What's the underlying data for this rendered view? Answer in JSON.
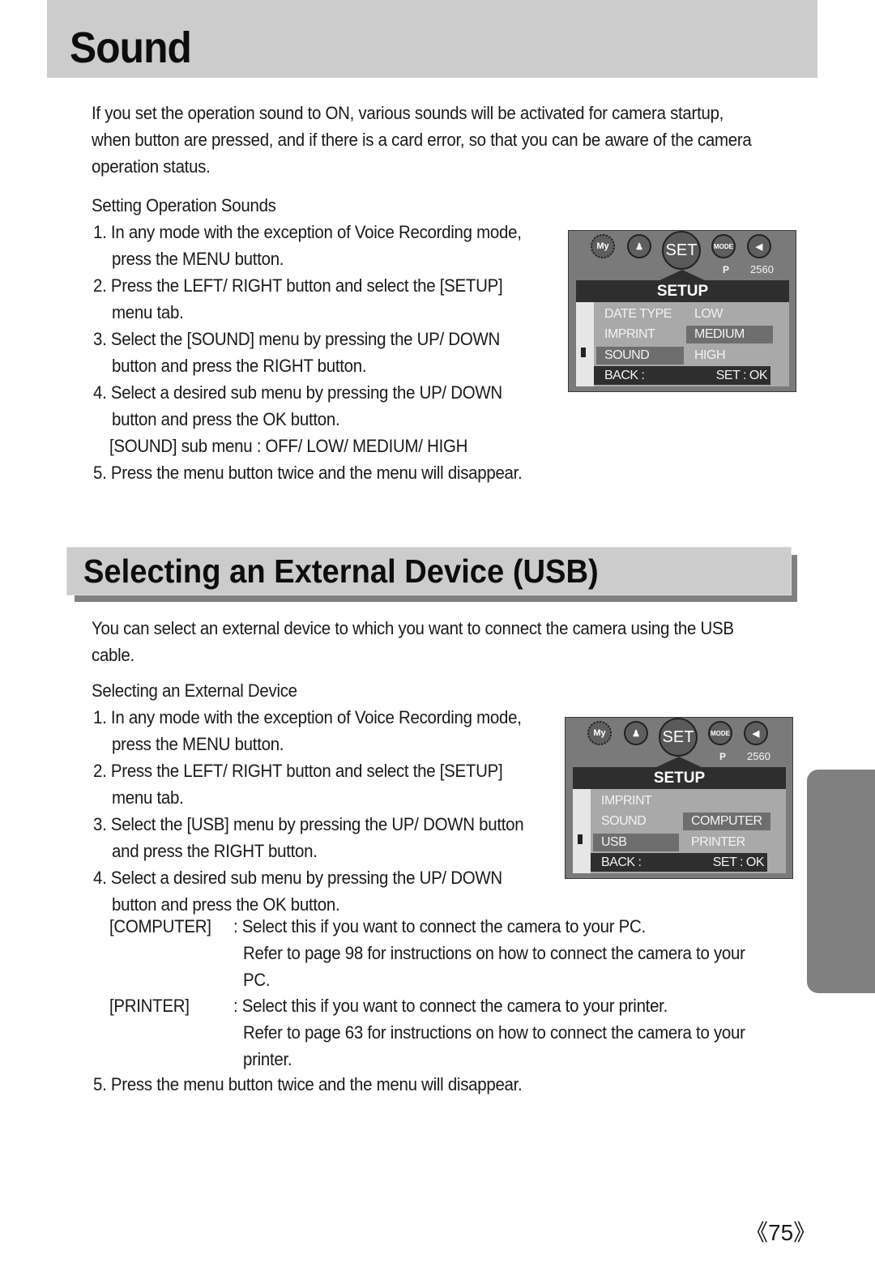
{
  "page_title": "Sound",
  "sound_section": {
    "intro": [
      "If you set the operation sound to ON, various sounds will be activated for camera startup,",
      "when button are pressed, and if there is a card error, so that you can be aware of the camera",
      "operation status."
    ],
    "subtitle": "Setting Operation Sounds",
    "steps": [
      "1. In any mode with the exception of Voice Recording mode,",
      "press the MENU button.",
      "2. Press the LEFT/ RIGHT button and select the [SETUP]",
      "menu tab.",
      "3. Select the [SOUND] menu by pressing the UP/ DOWN",
      "button and press the RIGHT button.",
      "4. Select a desired sub menu by pressing the UP/ DOWN",
      "button and press the OK button.",
      "[SOUND] sub menu : OFF/ LOW/ MEDIUM/ HIGH",
      "5. Press the menu button twice and the menu will disappear."
    ],
    "lcd": {
      "icons": [
        "My",
        "MODE",
        "SET"
      ],
      "mode": "P",
      "resolution": "2560",
      "header": "SETUP",
      "menu_items": [
        "DATE TYPE",
        "IMPRINT",
        "SOUND"
      ],
      "selected_item": "SOUND",
      "sub_items": [
        "LOW",
        "MEDIUM",
        "HIGH"
      ],
      "selected_sub": "MEDIUM",
      "back_label": "BACK :",
      "ok_label": "SET : OK"
    }
  },
  "usb_section": {
    "title": "Selecting an External Device (USB)",
    "intro": [
      "You can select an external device to which you want to connect the camera using the USB",
      "cable."
    ],
    "subtitle": "Selecting an External Device",
    "steps": [
      "1. In any mode with the exception of Voice Recording mode,",
      "press the MENU button.",
      "2. Press the LEFT/ RIGHT button and select the [SETUP]",
      "menu tab.",
      "3. Select the [USB] menu by pressing the UP/ DOWN button",
      "and press the RIGHT button.",
      "4. Select a desired sub menu by pressing the UP/ DOWN",
      "button and press the OK button."
    ],
    "options": [
      {
        "label": "[COMPUTER]",
        "lines": [
          ": Select this if you want to connect the camera to your PC.",
          "Refer to page 98 for instructions on how to connect the camera to your",
          "PC."
        ]
      },
      {
        "label": "[PRINTER]",
        "lines": [
          ": Select this if you want to connect the camera to your printer.",
          "Refer to page 63 for instructions on how to connect the camera to your",
          "printer."
        ]
      }
    ],
    "final_step": "5. Press the menu button twice and the menu will disappear.",
    "lcd": {
      "icons": [
        "My",
        "MODE",
        "SET"
      ],
      "mode": "P",
      "resolution": "2560",
      "header": "SETUP",
      "menu_items": [
        "IMPRINT",
        "SOUND",
        "USB"
      ],
      "selected_item": "USB",
      "sub_items": [
        "COMPUTER",
        "PRINTER"
      ],
      "selected_sub": "COMPUTER",
      "back_label": "BACK :",
      "ok_label": "SET : OK"
    }
  },
  "page_number": "《75》"
}
